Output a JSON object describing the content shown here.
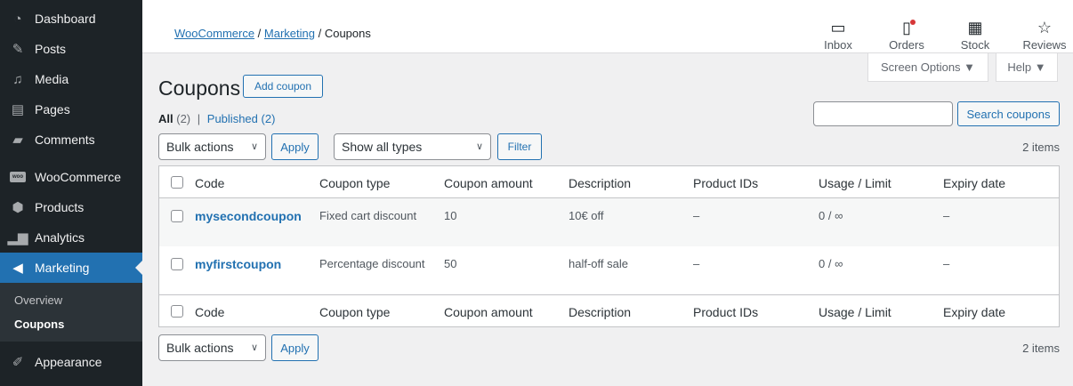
{
  "sidebar": {
    "items": [
      {
        "label": "Dashboard",
        "icon": "dashboard-icon"
      },
      {
        "label": "Posts",
        "icon": "pin-icon"
      },
      {
        "label": "Media",
        "icon": "media-icon"
      },
      {
        "label": "Pages",
        "icon": "pages-icon"
      },
      {
        "label": "Comments",
        "icon": "comment-icon"
      },
      {
        "label": "WooCommerce",
        "icon": "woocommerce-icon",
        "icon_text": "woo"
      },
      {
        "label": "Products",
        "icon": "box-icon"
      },
      {
        "label": "Analytics",
        "icon": "bar-chart-icon"
      },
      {
        "label": "Marketing",
        "icon": "megaphone-icon"
      }
    ],
    "submenu": {
      "overview": "Overview",
      "coupons": "Coupons"
    },
    "after": {
      "label": "Appearance",
      "icon": "brush-icon"
    },
    "active_color": "#2271b1"
  },
  "topbar": {
    "breadcrumb": {
      "part1": "WooCommerce",
      "sep1": " / ",
      "part2": "Marketing",
      "sep2": " / ",
      "current": "Coupons"
    },
    "activity": [
      {
        "label": "Inbox",
        "icon": "inbox-icon"
      },
      {
        "label": "Orders",
        "icon": "orders-icon"
      },
      {
        "label": "Stock",
        "icon": "stock-icon"
      },
      {
        "label": "Reviews",
        "icon": "star-icon"
      }
    ]
  },
  "screen_options": {
    "label": "Screen Options ▼",
    "help": "Help ▼"
  },
  "page": {
    "title": "Coupons",
    "add_button": "Add coupon",
    "filters": {
      "all": "All",
      "all_count": "(2)",
      "sep": "|",
      "published": "Published",
      "published_count": "(2)"
    },
    "search_button": "Search coupons",
    "search_value": "",
    "bulk_actions": "Bulk actions",
    "apply": "Apply",
    "type_filter": "Show all types",
    "filter_button": "Filter",
    "items_count": "2 items"
  },
  "table": {
    "columns": [
      "Code",
      "Coupon type",
      "Coupon amount",
      "Description",
      "Product IDs",
      "Usage / Limit",
      "Expiry date"
    ],
    "rows": [
      {
        "code": "mysecondcoupon",
        "type": "Fixed cart discount",
        "amount": "10",
        "description": "10€ off",
        "product_ids": "–",
        "usage": "0 / ∞",
        "expiry": "–"
      },
      {
        "code": "myfirstcoupon",
        "type": "Percentage discount",
        "amount": "50",
        "description": "half-off sale",
        "product_ids": "–",
        "usage": "0 / ∞",
        "expiry": "–"
      }
    ]
  }
}
